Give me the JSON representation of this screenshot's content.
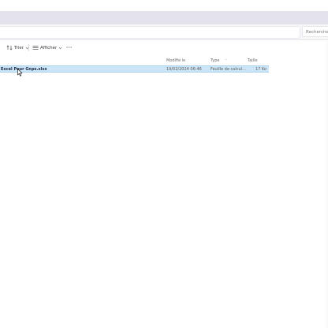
{
  "search": {
    "placeholder": "Rechercher"
  },
  "toolbar": {
    "sort_label": "Trier",
    "view_label": "Afficher",
    "more_label": "···"
  },
  "columns": {
    "modified": "Modifié le",
    "type": "Type",
    "size": "Taille"
  },
  "files": [
    {
      "name": "Excel Pour Gnps.xlsx",
      "modified": "19/02/2024 06:46",
      "type": "Feuille de calcul...",
      "size": "17 Ko",
      "selected": true
    }
  ],
  "colors": {
    "titlebar": "#e4e2ec",
    "selection": "#cde6f7",
    "selection_border": "#a7cfee"
  },
  "icons": [
    "sort-icon",
    "view-icon",
    "chevron-down-icon",
    "more-icon",
    "mouse-cursor-icon"
  ]
}
